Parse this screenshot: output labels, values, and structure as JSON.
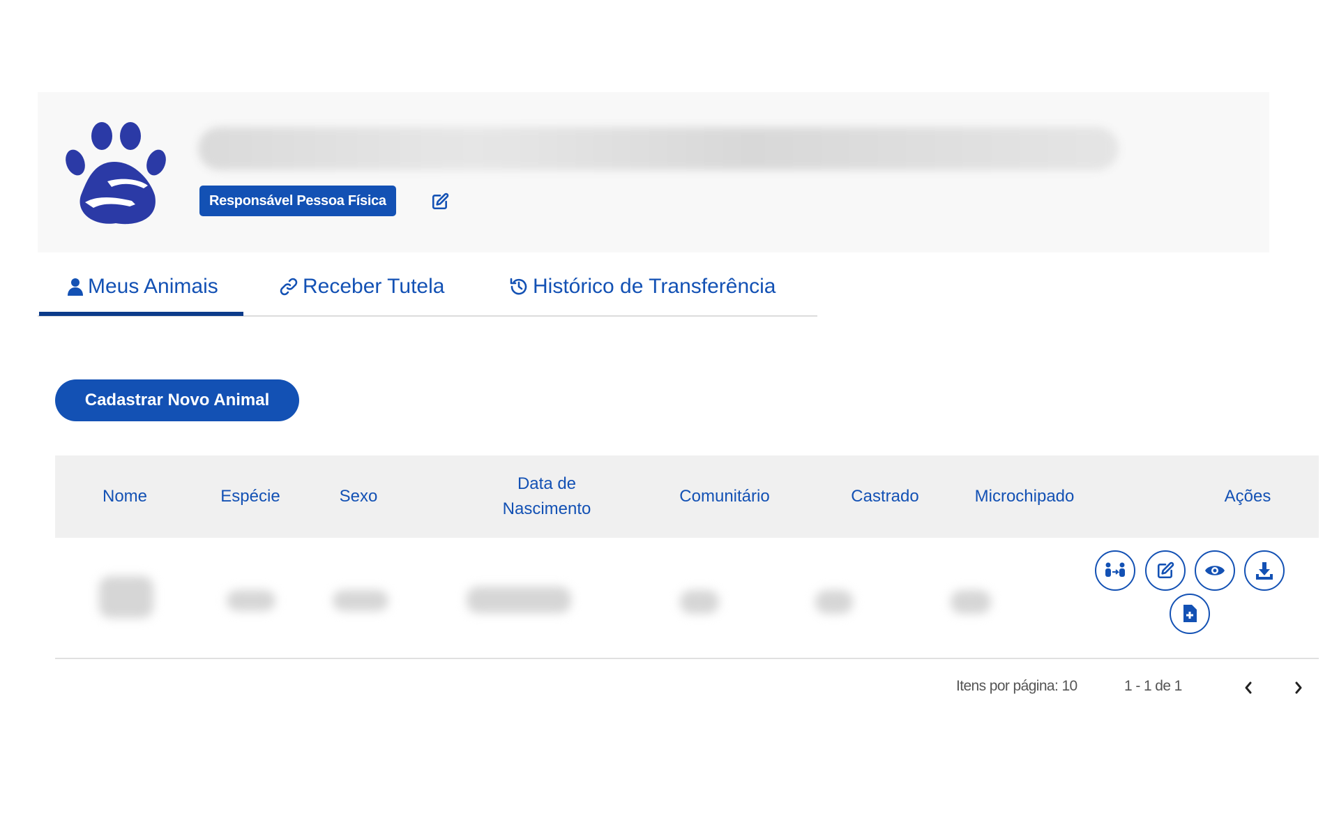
{
  "profile": {
    "role_badge": "Responsável Pessoa Física",
    "icons": {
      "logo": "paw-hug-logo",
      "edit": "edit-icon"
    }
  },
  "tabs": [
    {
      "label": "Meus Animais",
      "icon": "user-icon",
      "active": true
    },
    {
      "label": "Receber Tutela",
      "icon": "link-icon",
      "active": false
    },
    {
      "label": "Histórico de Transferência",
      "icon": "history-icon",
      "active": false
    }
  ],
  "actions": {
    "new_animal_label": "Cadastrar Novo Animal"
  },
  "table": {
    "headers": {
      "nome": "Nome",
      "especie": "Espécie",
      "sexo": "Sexo",
      "data_nascimento_line1": "Data de",
      "data_nascimento_line2": "Nascimento",
      "comunitario": "Comunitário",
      "castrado": "Castrado",
      "microchipado": "Microchipado",
      "acoes": "Ações"
    },
    "row_action_icons": [
      "transfer-icon",
      "edit-icon",
      "view-icon",
      "download-icon",
      "document-add-icon"
    ]
  },
  "paginator": {
    "items_per_page": "Itens por página: 10",
    "range": "1 - 1 de 1"
  },
  "colors": {
    "primary": "#1351b4",
    "tab_underline": "#0c3b8a",
    "header_bg": "#f0f0f0"
  }
}
